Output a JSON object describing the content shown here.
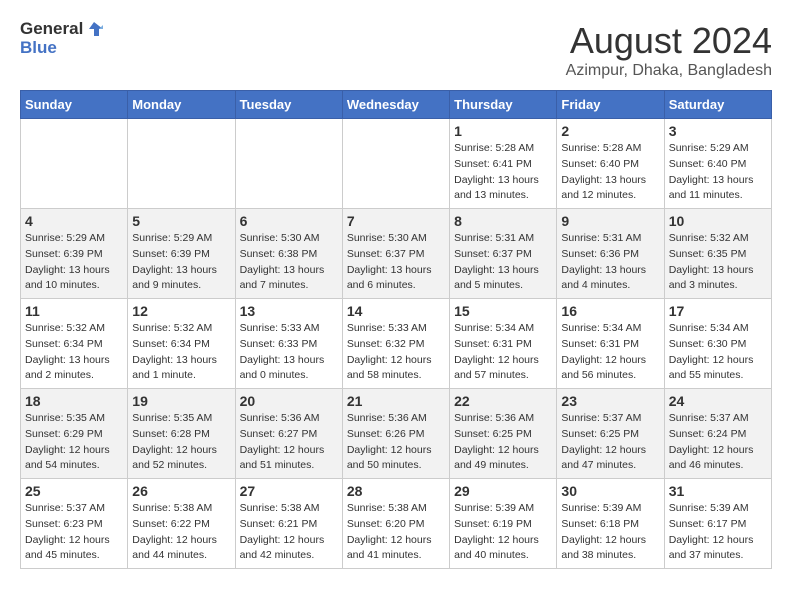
{
  "logo": {
    "general": "General",
    "blue": "Blue"
  },
  "title": "August 2024",
  "subtitle": "Azimpur, Dhaka, Bangladesh",
  "weekdays": [
    "Sunday",
    "Monday",
    "Tuesday",
    "Wednesday",
    "Thursday",
    "Friday",
    "Saturday"
  ],
  "weeks": [
    [
      {
        "day": "",
        "info": ""
      },
      {
        "day": "",
        "info": ""
      },
      {
        "day": "",
        "info": ""
      },
      {
        "day": "",
        "info": ""
      },
      {
        "day": "1",
        "info": "Sunrise: 5:28 AM\nSunset: 6:41 PM\nDaylight: 13 hours\nand 13 minutes."
      },
      {
        "day": "2",
        "info": "Sunrise: 5:28 AM\nSunset: 6:40 PM\nDaylight: 13 hours\nand 12 minutes."
      },
      {
        "day": "3",
        "info": "Sunrise: 5:29 AM\nSunset: 6:40 PM\nDaylight: 13 hours\nand 11 minutes."
      }
    ],
    [
      {
        "day": "4",
        "info": "Sunrise: 5:29 AM\nSunset: 6:39 PM\nDaylight: 13 hours\nand 10 minutes."
      },
      {
        "day": "5",
        "info": "Sunrise: 5:29 AM\nSunset: 6:39 PM\nDaylight: 13 hours\nand 9 minutes."
      },
      {
        "day": "6",
        "info": "Sunrise: 5:30 AM\nSunset: 6:38 PM\nDaylight: 13 hours\nand 7 minutes."
      },
      {
        "day": "7",
        "info": "Sunrise: 5:30 AM\nSunset: 6:37 PM\nDaylight: 13 hours\nand 6 minutes."
      },
      {
        "day": "8",
        "info": "Sunrise: 5:31 AM\nSunset: 6:37 PM\nDaylight: 13 hours\nand 5 minutes."
      },
      {
        "day": "9",
        "info": "Sunrise: 5:31 AM\nSunset: 6:36 PM\nDaylight: 13 hours\nand 4 minutes."
      },
      {
        "day": "10",
        "info": "Sunrise: 5:32 AM\nSunset: 6:35 PM\nDaylight: 13 hours\nand 3 minutes."
      }
    ],
    [
      {
        "day": "11",
        "info": "Sunrise: 5:32 AM\nSunset: 6:34 PM\nDaylight: 13 hours\nand 2 minutes."
      },
      {
        "day": "12",
        "info": "Sunrise: 5:32 AM\nSunset: 6:34 PM\nDaylight: 13 hours\nand 1 minute."
      },
      {
        "day": "13",
        "info": "Sunrise: 5:33 AM\nSunset: 6:33 PM\nDaylight: 13 hours\nand 0 minutes."
      },
      {
        "day": "14",
        "info": "Sunrise: 5:33 AM\nSunset: 6:32 PM\nDaylight: 12 hours\nand 58 minutes."
      },
      {
        "day": "15",
        "info": "Sunrise: 5:34 AM\nSunset: 6:31 PM\nDaylight: 12 hours\nand 57 minutes."
      },
      {
        "day": "16",
        "info": "Sunrise: 5:34 AM\nSunset: 6:31 PM\nDaylight: 12 hours\nand 56 minutes."
      },
      {
        "day": "17",
        "info": "Sunrise: 5:34 AM\nSunset: 6:30 PM\nDaylight: 12 hours\nand 55 minutes."
      }
    ],
    [
      {
        "day": "18",
        "info": "Sunrise: 5:35 AM\nSunset: 6:29 PM\nDaylight: 12 hours\nand 54 minutes."
      },
      {
        "day": "19",
        "info": "Sunrise: 5:35 AM\nSunset: 6:28 PM\nDaylight: 12 hours\nand 52 minutes."
      },
      {
        "day": "20",
        "info": "Sunrise: 5:36 AM\nSunset: 6:27 PM\nDaylight: 12 hours\nand 51 minutes."
      },
      {
        "day": "21",
        "info": "Sunrise: 5:36 AM\nSunset: 6:26 PM\nDaylight: 12 hours\nand 50 minutes."
      },
      {
        "day": "22",
        "info": "Sunrise: 5:36 AM\nSunset: 6:25 PM\nDaylight: 12 hours\nand 49 minutes."
      },
      {
        "day": "23",
        "info": "Sunrise: 5:37 AM\nSunset: 6:25 PM\nDaylight: 12 hours\nand 47 minutes."
      },
      {
        "day": "24",
        "info": "Sunrise: 5:37 AM\nSunset: 6:24 PM\nDaylight: 12 hours\nand 46 minutes."
      }
    ],
    [
      {
        "day": "25",
        "info": "Sunrise: 5:37 AM\nSunset: 6:23 PM\nDaylight: 12 hours\nand 45 minutes."
      },
      {
        "day": "26",
        "info": "Sunrise: 5:38 AM\nSunset: 6:22 PM\nDaylight: 12 hours\nand 44 minutes."
      },
      {
        "day": "27",
        "info": "Sunrise: 5:38 AM\nSunset: 6:21 PM\nDaylight: 12 hours\nand 42 minutes."
      },
      {
        "day": "28",
        "info": "Sunrise: 5:38 AM\nSunset: 6:20 PM\nDaylight: 12 hours\nand 41 minutes."
      },
      {
        "day": "29",
        "info": "Sunrise: 5:39 AM\nSunset: 6:19 PM\nDaylight: 12 hours\nand 40 minutes."
      },
      {
        "day": "30",
        "info": "Sunrise: 5:39 AM\nSunset: 6:18 PM\nDaylight: 12 hours\nand 38 minutes."
      },
      {
        "day": "31",
        "info": "Sunrise: 5:39 AM\nSunset: 6:17 PM\nDaylight: 12 hours\nand 37 minutes."
      }
    ]
  ]
}
